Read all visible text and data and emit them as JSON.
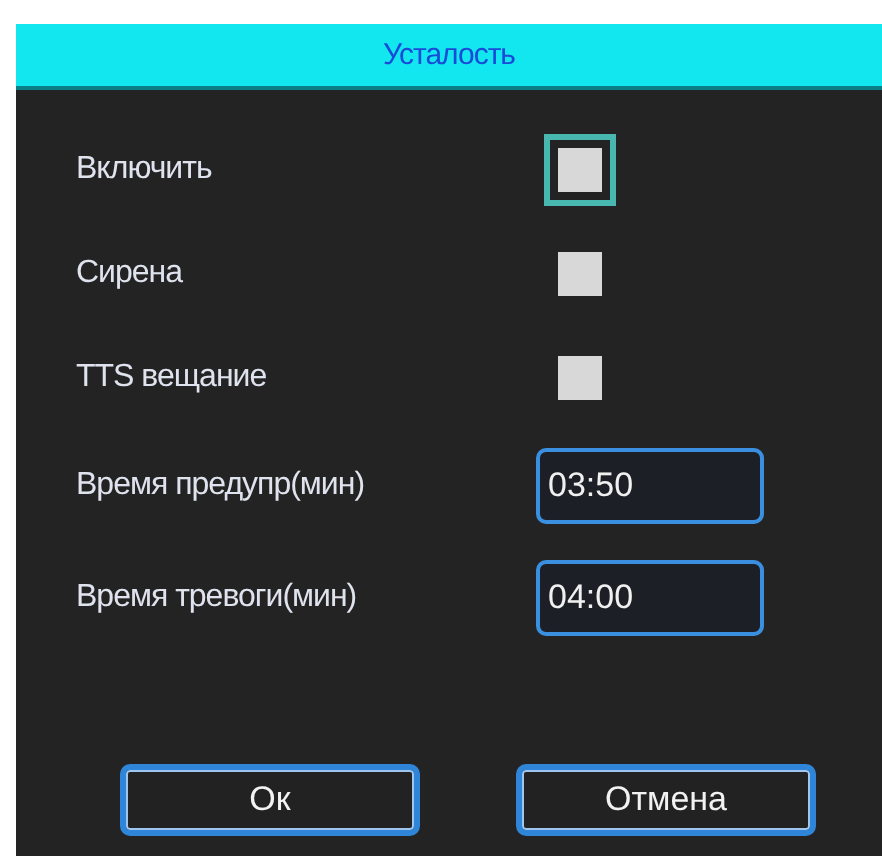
{
  "dialog": {
    "title": "Усталость"
  },
  "checkboxes": [
    {
      "label": "Включить",
      "checked": false,
      "focused": true
    },
    {
      "label": "Сирена",
      "checked": false,
      "focused": false
    },
    {
      "label": "TTS вещание",
      "checked": false,
      "focused": false
    }
  ],
  "fields": [
    {
      "label": "Время предупр(мин)",
      "value": "03:50"
    },
    {
      "label": "Время тревоги(мин)",
      "value": "04:00"
    }
  ],
  "buttons": [
    "Ок",
    "Отмена"
  ]
}
